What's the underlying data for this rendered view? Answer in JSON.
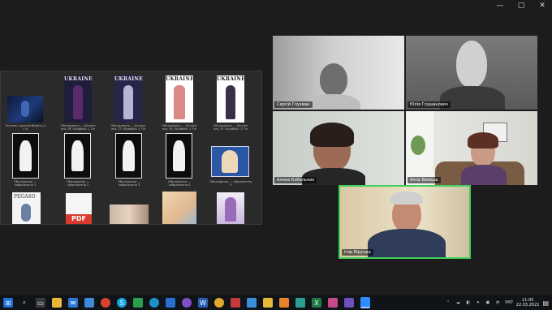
{
  "window": {
    "minimize_icon": "—",
    "restore_icon": "▢",
    "close_icon": "✕"
  },
  "shared_screen": {
    "thumbs_row1": [
      {
        "caption": "Ганзань поклока бывать а 1 в",
        "kind": "photo"
      },
      {
        "caption": "Обкладинка — Ukraine аль 76 «Прибой» 1 Тіп",
        "kind": "mag",
        "title": "UKRAINE"
      },
      {
        "caption": "Обкладинка — Ukraine аль 77 «Прибой» 1 Тіп",
        "kind": "mag",
        "title": "UKRAINE"
      },
      {
        "caption": "Обкладинка — Ukraine аль 78 «Прибой» 1 Тіп",
        "kind": "mag",
        "title": "UKRAINE"
      },
      {
        "caption": "Обкладинка — Ukraine аль 79 «Прибой» 1 Тіп",
        "kind": "mag",
        "title": "UKRAINE"
      }
    ],
    "thumbs_row2": [
      {
        "caption": "Обкладинка — зображення 1",
        "kind": "black"
      },
      {
        "caption": "Обкладинка — зображення 2",
        "kind": "black"
      },
      {
        "caption": "Обкладинка — зображення 3",
        "kind": "black"
      },
      {
        "caption": "Обкладинка — зображення 4",
        "kind": "black"
      },
      {
        "caption": "Обкладинка — зображення 5",
        "kind": "art"
      }
    ],
    "thumbs_row3": [
      {
        "caption": "",
        "kind": "pegaso",
        "title": "PEGASO"
      },
      {
        "caption": "",
        "kind": "pdf",
        "title": "PDF"
      },
      {
        "caption": "",
        "kind": "photo2"
      },
      {
        "caption": "",
        "kind": "photo3"
      },
      {
        "caption": "",
        "kind": "photo4"
      }
    ]
  },
  "participants": [
    {
      "name": "Сергій Глузман"
    },
    {
      "name": "Юлія Глушанович"
    },
    {
      "name": "Алина Кобильник"
    },
    {
      "name": "Алла Бекешь"
    },
    {
      "name": "Ігор Вірунда"
    }
  ],
  "taskbar": {
    "lang": "УКР",
    "time": "11:05",
    "date": "22.03.2021"
  }
}
